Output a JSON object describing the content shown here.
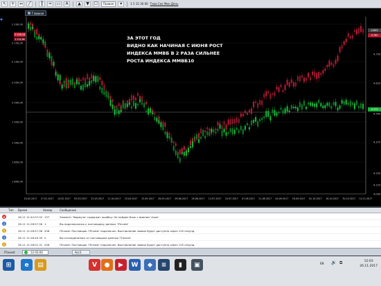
{
  "toolbar": {
    "instrument_select": "Правая",
    "timeframe_text": "1 5 15 30 60",
    "chart_types_text": "Тики Сек Мин День",
    "buttons": [
      "↖",
      "+",
      "↔",
      "╱",
      "┃",
      "═",
      "▭",
      "A",
      "▲",
      "▼",
      "☐"
    ]
  },
  "chart": {
    "tab_label": "Главная",
    "annotation": [
      "ЗА ЭТОТ ГОД",
      "ВИДНО КАК НАЧИНАЯ С ИЮНЯ РОСТ",
      "ИНДЕКСА ММВБ В 2 РАЗА СИЛЬНЕЕ",
      "РОСТА ИНДЕКСА ММВБ10"
    ],
    "left_axis": [
      "2 200,00",
      "2 150,00",
      "2 100,00",
      "2 050,00",
      "2 000,00",
      "1 950,00",
      "1 900,00",
      "1 850,00",
      "1 800,00"
    ],
    "left_tag": "2 126,16",
    "left_sub_tag": "2 214,98",
    "right_axis": [
      "4.750",
      "4.625",
      "4.500",
      "4.375",
      "4.250",
      "4.125",
      "4.000"
    ],
    "right_top_tag": "4.893",
    "right_red_tag": "4.780",
    "right_green_tag": "4.373",
    "dates": [
      "10.01.2017",
      "27.01.2017",
      "14.02.2017",
      "03.03.2017",
      "22.03.2017",
      "11.04.2017",
      "25.04.2017",
      "12.05.2017",
      "26.05.2017",
      "09.06.2017",
      "28.06.2017",
      "12.07.2017",
      "24.07.2017",
      "07.08.2017",
      "21.08.2017",
      "04.09.2017",
      "18.09.2017",
      "02.10.2017",
      "16.10.2017",
      "30.10.2017",
      "14.11.2017"
    ],
    "colors": {
      "background": "#000000",
      "up": "#19b33a",
      "down": "#b21b33",
      "annotation": "#ffffff",
      "line": "#d4d4d4"
    }
  },
  "log": {
    "headers": [
      "Тип",
      "Время",
      "Номер",
      "Сообщение"
    ],
    "rows": [
      {
        "type": "error",
        "time": "26.11 11:42:07.02",
        "number": "137",
        "message": "Элемент 'Формула' содержит ошибку: Не найден блок с именем 'close'."
      },
      {
        "type": "info",
        "time": "26.11 11:28:57.56",
        "number": "1",
        "message": "Вы подключились к поставщику данных 'ITinvest'"
      },
      {
        "type": "warn",
        "time": "26.11 11:28:57.58",
        "number": "208",
        "message": "ITinvest: Поставщик 'ITinvest' подключен. Выставление заявок будет доступно через 120 секунд."
      },
      {
        "type": "info",
        "time": "26.11 11:28:40.35",
        "number": "2",
        "message": "Вы отсоединились от поставщика данных 'ITinvest'"
      },
      {
        "type": "warn",
        "time": "26.11 11:28:01.31",
        "number": "208",
        "message": "ITinvest: Поставщик 'ITinvest' подключен. Выставление заявок будет доступно через 120 секунд."
      }
    ]
  },
  "status": {
    "connection": "ITinvest",
    "server_time": "12:03:00",
    "account": "Acc1"
  },
  "taskbar": {
    "apps": [
      {
        "name": "start",
        "glyph": "⊞",
        "color": "#1c5aa6"
      },
      {
        "name": "ie",
        "glyph": "e",
        "color": "#1f77c9"
      },
      {
        "name": "explorer",
        "glyph": "▤",
        "color": "#d89a1e"
      },
      {
        "name": "vivaldi",
        "glyph": "V",
        "color": "#d6302d"
      },
      {
        "name": "app-orange",
        "glyph": "●",
        "color": "#e36e16"
      },
      {
        "name": "app-red",
        "glyph": "▶",
        "color": "#c8212d"
      },
      {
        "name": "word",
        "glyph": "W",
        "color": "#2a5fae"
      },
      {
        "name": "app-blue",
        "glyph": "◆",
        "color": "#3b6fb6"
      },
      {
        "name": "app-navy",
        "glyph": "≡",
        "color": "#26466d"
      },
      {
        "name": "tslab",
        "glyph": "▮",
        "color": "#222222"
      },
      {
        "name": "app-dark",
        "glyph": "▣",
        "color": "#44515f"
      }
    ],
    "language": "EN",
    "time": "12:03",
    "date": "26.11.2017"
  }
}
